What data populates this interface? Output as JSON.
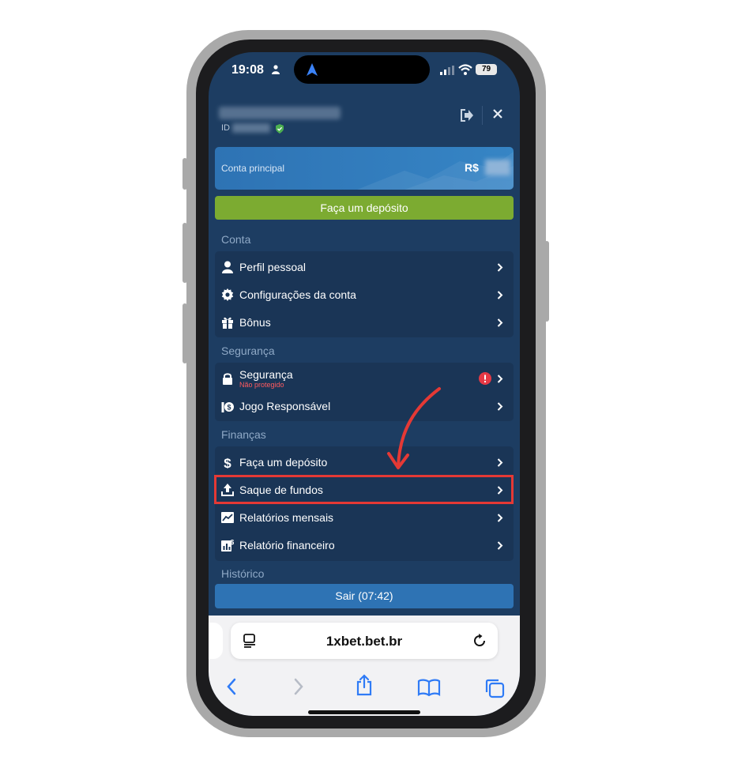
{
  "status_bar": {
    "time": "19:08",
    "battery": "79"
  },
  "header": {
    "id_label": "ID"
  },
  "account": {
    "label": "Conta principal",
    "currency": "R$"
  },
  "deposit_button": "Faça um depósito",
  "sections": {
    "conta": "Conta",
    "seguranca": "Segurança",
    "financas": "Finanças",
    "historico": "Histórico"
  },
  "menu": {
    "perfil": "Perfil pessoal",
    "configuracoes": "Configurações da conta",
    "bonus": "Bônus",
    "seguranca": "Segurança",
    "seguranca_status": "Não protegido",
    "jogo_responsavel": "Jogo Responsável",
    "deposito": "Faça um depósito",
    "saque": "Saque de fundos",
    "relatorios_mensais": "Relatórios mensais",
    "relatorio_financeiro": "Relatório financeiro"
  },
  "logout_button": "Sair (07:42)",
  "browser": {
    "url": "1xbet.bet.br"
  },
  "colors": {
    "panel": "#1d3d62",
    "accent_green": "#7cab31",
    "accent_blue": "#2e73b4",
    "highlight_red": "#e53935"
  }
}
